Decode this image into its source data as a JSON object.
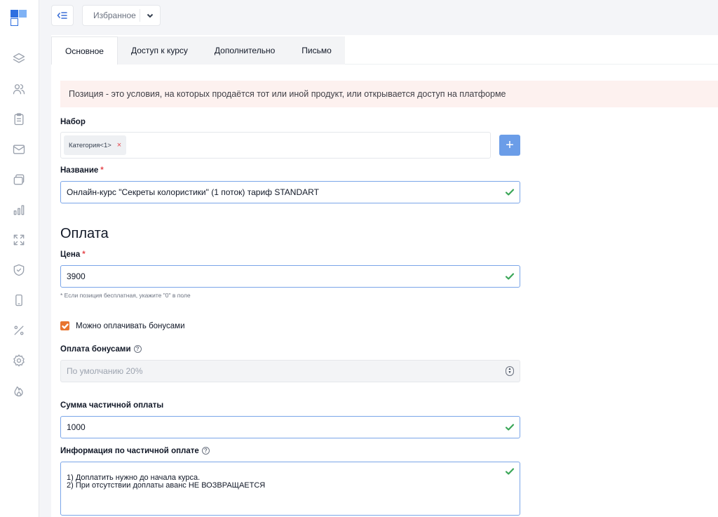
{
  "topbar": {
    "favorites_label": "Избранное"
  },
  "sidebar": {
    "icons": [
      "layers-icon",
      "users-icon",
      "clipboard-icon",
      "mail-icon",
      "cards-icon",
      "bar-chart-icon",
      "expand-icon",
      "shield-icon",
      "mobile-icon",
      "percent-icon",
      "gear-icon",
      "fire-icon"
    ]
  },
  "tabs": [
    {
      "label": "Основное",
      "active": true
    },
    {
      "label": "Доступ к курсу",
      "active": false
    },
    {
      "label": "Дополнительно",
      "active": false
    },
    {
      "label": "Письмо",
      "active": false
    }
  ],
  "notice": "Позиция - это условия, на которых продаётся тот или иной продукт, или открывается доступ на платформе",
  "form": {
    "set_label": "Набор",
    "set_tag": "Категория<1>",
    "tag_remove": "×",
    "add_button": "+",
    "name_label": "Название",
    "required_mark": "*",
    "name_value": "Онлайн-курс \"Секреты колористики\" (1 поток) тариф STANDART",
    "payment_title": "Оплата",
    "price_label": "Цена",
    "price_value": "3900",
    "price_hint": "* Если позиция бесплатная, укажите \"0\" в поле",
    "bonus_checkbox_label": "Можно оплачивать бонусами",
    "bonus_checked": true,
    "bonus_payment_label": "Оплата бонусами",
    "bonus_payment_placeholder": "По умолчанию 20%",
    "partial_sum_label": "Сумма частичной оплаты",
    "partial_sum_value": "1000",
    "partial_info_label": "Информация по частичной оплате",
    "partial_info_value": "1) Доплатить нужно до начала курса.\n2) При отсутствии доплаты аванс НЕ ВОЗВРАЩАЕТСЯ"
  },
  "colors": {
    "accent": "#3b6fd6",
    "checkbox": "#e8742f",
    "valid": "#3aa657",
    "notice_bg": "#fdf1ef"
  }
}
